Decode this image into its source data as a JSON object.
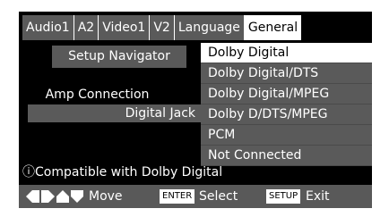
{
  "tabs": [
    "Audio1",
    "A2",
    "Video1",
    "V2",
    "Language",
    "General"
  ],
  "left": {
    "setup_navigator": "Setup Navigator",
    "amp_connection": "Amp Connection",
    "digital_jack": "Digital Jack"
  },
  "options": [
    "Dolby Digital",
    "Dolby Digital/DTS",
    "Dolby Digital/MPEG",
    "Dolby D/DTS/MPEG",
    "PCM",
    "Not Connected"
  ],
  "info": {
    "icon": "ⓘ",
    "text": "Compatible with Dolby Digital"
  },
  "footer": {
    "move_label": "Move",
    "enter_key": "ENTER",
    "select_label": "Select",
    "setup_key": "SETUP",
    "exit_label": "Exit"
  }
}
